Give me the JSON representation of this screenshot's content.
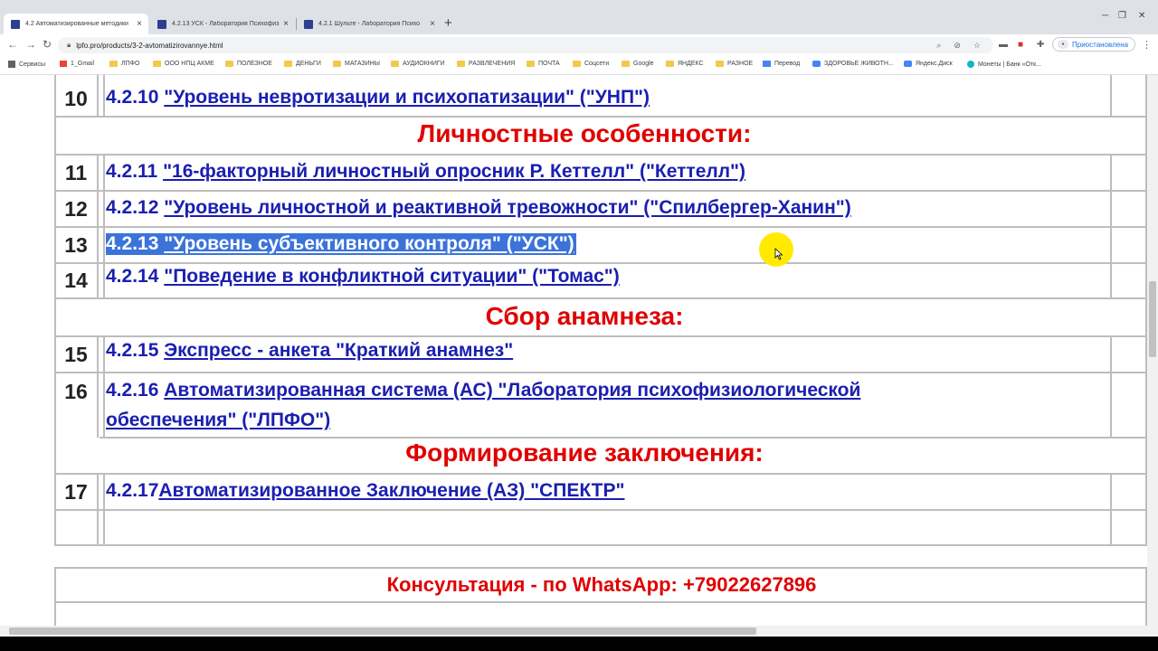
{
  "browser": {
    "tabs": [
      {
        "title": "4.2 Автоматизированные методики"
      },
      {
        "title": "4.2.13 УСК - Лаборатория Психофиз"
      },
      {
        "title": "4.2.1 Шульте - Лаборатория Психо"
      }
    ],
    "new_tab": "+",
    "url": "lpfo.pro/products/3-2-avtomatizirovannye.html",
    "profile_label": "Приостановлена"
  },
  "bookmarks": [
    {
      "label": "Сервисы",
      "icon": "apps-grid-icon"
    },
    {
      "label": "1_Gmail",
      "icon": "gmail-icon"
    },
    {
      "label": "ЛПФО",
      "icon": "folder-icon"
    },
    {
      "label": "ООО НПЦ АКМЕ",
      "icon": "folder-icon"
    },
    {
      "label": "ПОЛЕЗНОЕ",
      "icon": "folder-icon"
    },
    {
      "label": "ДЕНЬГИ",
      "icon": "folder-icon"
    },
    {
      "label": "МАГАЗИНЫ",
      "icon": "folder-icon"
    },
    {
      "label": "АУДИОКНИГИ",
      "icon": "folder-icon"
    },
    {
      "label": "РАЗВЛЕЧЕНИЯ",
      "icon": "folder-icon"
    },
    {
      "label": "ПОЧТА",
      "icon": "folder-icon"
    },
    {
      "label": "Соцсети",
      "icon": "folder-icon"
    },
    {
      "label": "Google",
      "icon": "folder-icon"
    },
    {
      "label": "ЯНДЕКС",
      "icon": "folder-icon"
    },
    {
      "label": "РАЗНОЕ",
      "icon": "folder-icon"
    },
    {
      "label": "Перевод",
      "icon": "translate-icon"
    },
    {
      "label": "ЗДОРОВЬЕ ЖИВОТН...",
      "icon": "site-icon"
    },
    {
      "label": "Яндекс.Диск",
      "icon": "cloud-icon"
    },
    {
      "label": "Монеты | Банк «Отк...",
      "icon": "coin-icon"
    }
  ],
  "rows": [
    {
      "num": "10",
      "code": "4.2.10",
      "link": "\"Уровень невротизации и психопатизации\" (\"УНП\")"
    },
    {
      "num": "11",
      "code": "4.2.11",
      "link": "\"16-факторный личностный опросник Р. Кеттелл\" (\"Кеттелл\")"
    },
    {
      "num": "12",
      "code": "4.2.12",
      "link": "\"Уровень личностной и реактивной тревожности\" (\"Спилбергер-Ханин\")"
    },
    {
      "num": "13",
      "code": "4.2.13",
      "link": "\"Уровень субъективного контроля\" (\"УСК\")"
    },
    {
      "num": "14",
      "code": "4.2.14",
      "link": "\"Поведение в конфликтной ситуации\" (\"Томас\")"
    },
    {
      "num": "15",
      "code": "4.2.15",
      "link": "Экспресс - анкета \"Краткий анамнез\""
    },
    {
      "num": "16",
      "code": "4.2.16",
      "link": "Автоматизированная система (АС) \"Лаборатория психофизиологической",
      "link2": "обеспечения\" (\"ЛПФО\")"
    },
    {
      "num": "17",
      "code": "4.2.17",
      "link": "Автоматизированное Заключение (АЗ) \"СПЕКТР\""
    }
  ],
  "headings": {
    "personal": "Личностные особенности:",
    "anamnesis": "Сбор анамнеза:",
    "conclusion": "Формирование заключения:"
  },
  "consultation": "Консультация - по WhatsApp: +79022627896",
  "colors": {
    "link": "#1a1fb0",
    "heading": "#e00000",
    "selection": "#3b73d9",
    "cursor_highlight": "#ffea00"
  }
}
